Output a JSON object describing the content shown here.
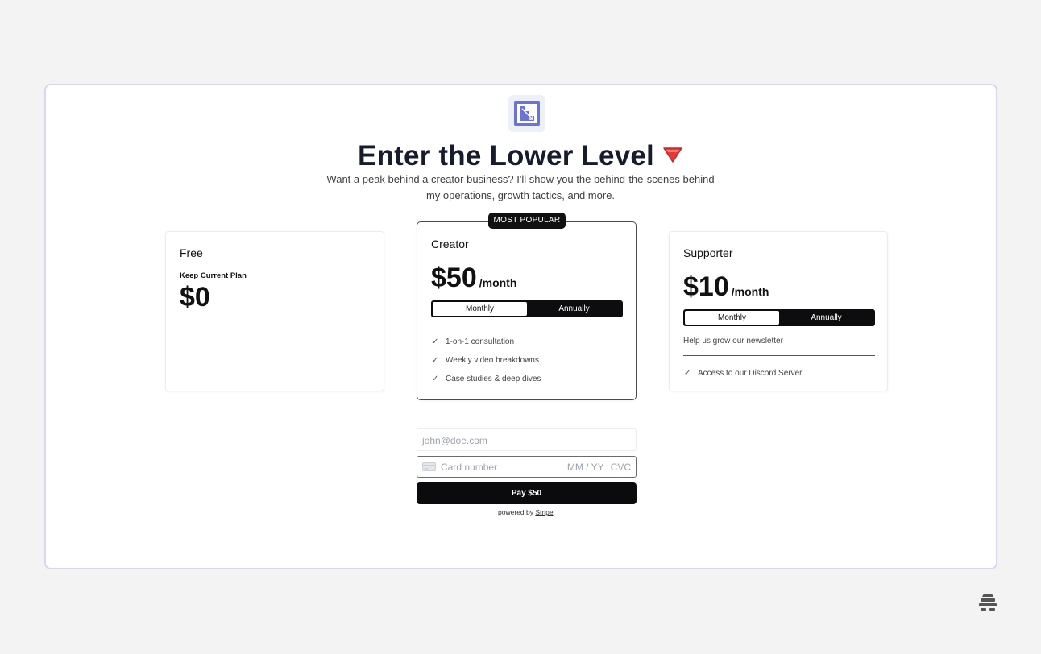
{
  "header": {
    "title": "Enter the Lower Level",
    "title_emoji_icon": "red-triangle-down-icon",
    "subtitle": "Want a peak behind a creator business? I'll show you the behind-the-scenes behind my operations, growth tactics, and more."
  },
  "plans": {
    "free": {
      "name": "Free",
      "note": "Keep Current Plan",
      "price": "$0"
    },
    "creator": {
      "badge": "MOST POPULAR",
      "name": "Creator",
      "price": "$50",
      "period": "/month",
      "toggle": {
        "monthly": "Monthly",
        "annually": "Annually",
        "selected": "Monthly"
      },
      "features": [
        "1-on-1 consultation",
        "Weekly video breakdowns",
        "Case studies & deep dives"
      ]
    },
    "supporter": {
      "name": "Supporter",
      "price": "$10",
      "period": "/month",
      "toggle": {
        "monthly": "Monthly",
        "annually": "Annually",
        "selected": "Monthly"
      },
      "description": "Help us grow our newsletter",
      "features": [
        "Access to our Discord Server"
      ]
    }
  },
  "checkout": {
    "email_placeholder": "john@doe.com",
    "card_placeholder": "Card number",
    "expiry_placeholder": "MM / YY",
    "cvc_placeholder": "CVC",
    "pay_label": "Pay $50",
    "powered_prefix": "powered by ",
    "powered_link": "Stripe",
    "powered_suffix": "."
  },
  "colors": {
    "accent": "#6b72d8",
    "frame_border": "#d9d6f3",
    "dark": "#0b0b0d"
  }
}
